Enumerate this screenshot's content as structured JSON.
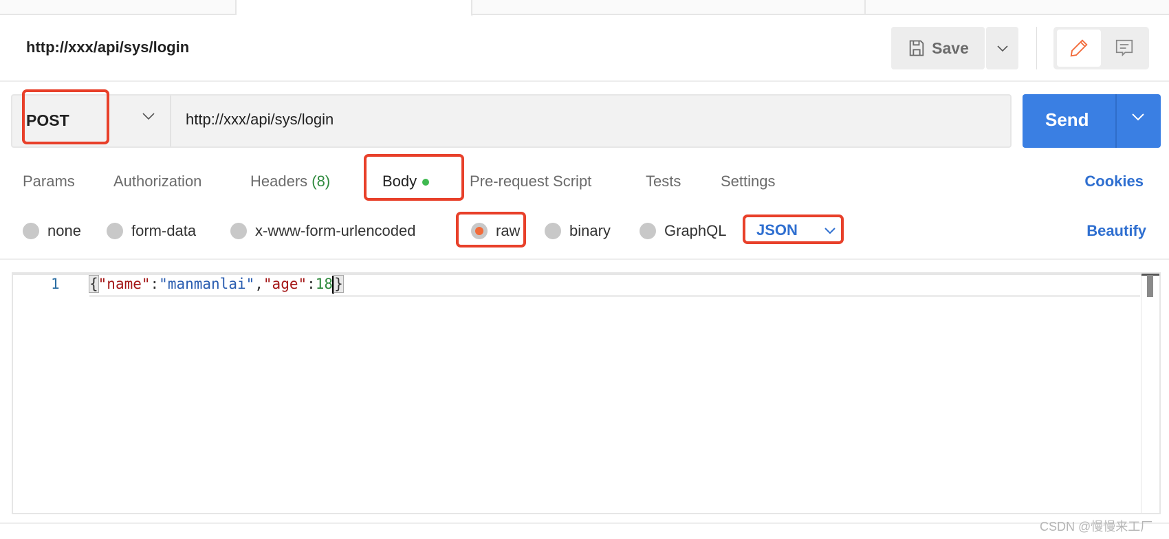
{
  "header": {
    "title": "http://xxx/api/sys/login",
    "save_label": "Save"
  },
  "request": {
    "method": "POST",
    "url": "http://xxx/api/sys/login",
    "send_label": "Send"
  },
  "tabs": [
    {
      "label": "Params"
    },
    {
      "label": "Authorization"
    },
    {
      "label": "Headers",
      "count": "(8)"
    },
    {
      "label": "Body",
      "active": true
    },
    {
      "label": "Pre-request Script"
    },
    {
      "label": "Tests"
    },
    {
      "label": "Settings"
    }
  ],
  "cookies_label": "Cookies",
  "body_types": [
    {
      "label": "none"
    },
    {
      "label": "form-data"
    },
    {
      "label": "x-www-form-urlencoded"
    },
    {
      "label": "raw",
      "selected": true
    },
    {
      "label": "binary"
    },
    {
      "label": "GraphQL"
    }
  ],
  "raw_language": "JSON",
  "beautify_label": "Beautify",
  "editor": {
    "line_number": "1",
    "tokens": {
      "open": "{",
      "k1": "\"name\"",
      "c1": ":",
      "v1": "\"manmanlai\"",
      "comma": ",",
      "k2": "\"age\"",
      "c2": ":",
      "v2": "18",
      "close": "}"
    }
  },
  "watermark": "CSDN @慢慢来工厂",
  "colors": {
    "accent": "#f26b3a",
    "send": "#3a7fe3",
    "link": "#2f6fd0",
    "highlight": "#e8402a"
  }
}
